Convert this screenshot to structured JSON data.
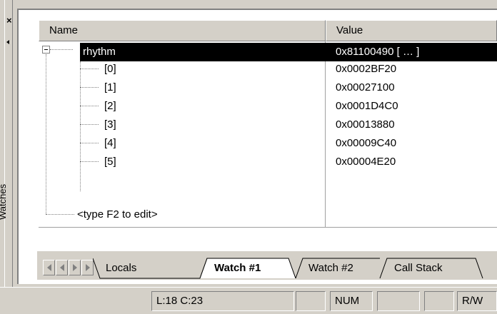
{
  "dock": {
    "close_glyph": "×",
    "title": "Watches"
  },
  "grid": {
    "headers": {
      "name": "Name",
      "value": "Value"
    },
    "rows": [
      {
        "name": "rhythm",
        "value": "0x81100490 [ … ]"
      },
      {
        "name": "[0]",
        "value": "0x0002BF20"
      },
      {
        "name": "[1]",
        "value": "0x00027100"
      },
      {
        "name": "[2]",
        "value": "0x0001D4C0"
      },
      {
        "name": "[3]",
        "value": "0x00013880"
      },
      {
        "name": "[4]",
        "value": "0x00009C40"
      },
      {
        "name": "[5]",
        "value": "0x00004E20"
      }
    ],
    "edit_placeholder": "<type F2 to edit>",
    "expander_state": "expanded"
  },
  "tabs": [
    {
      "label": "Locals",
      "active": false
    },
    {
      "label": "Watch #1",
      "active": true
    },
    {
      "label": "Watch #2",
      "active": false
    },
    {
      "label": "Call Stack",
      "active": false
    }
  ],
  "statusbar": {
    "position": "L:18 C:23",
    "num": "NUM",
    "mode": "R/W"
  },
  "colors": {
    "chrome": "#d4d0c8",
    "selection": "#000000",
    "selection_text": "#ffffff"
  }
}
